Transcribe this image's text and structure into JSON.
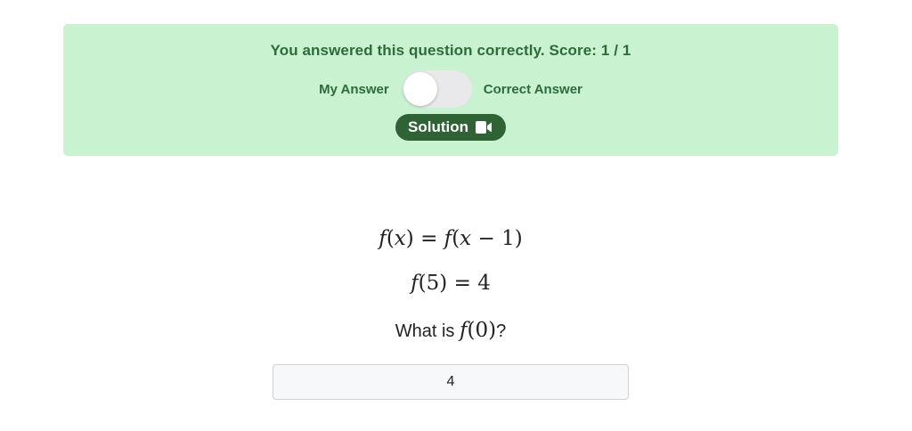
{
  "result": {
    "message": "You answered this question correctly. Score: 1 / 1",
    "toggle": {
      "left_label": "My Answer",
      "right_label": "Correct Answer",
      "state": "My Answer"
    },
    "solution_button": {
      "label": "Solution",
      "icon": "video-camera-icon"
    }
  },
  "problem": {
    "equation_1": {
      "lhs_fn": "f",
      "lhs_arg": "x",
      "equals": "=",
      "rhs_fn": "f",
      "rhs_arg": "x",
      "rhs_op": "−",
      "rhs_num": "1"
    },
    "equation_2": {
      "fn": "f",
      "arg": "5",
      "equals": "=",
      "value": "4"
    },
    "question": {
      "prefix": "What is ",
      "fn": "f",
      "arg": "0",
      "suffix": "?"
    }
  },
  "answer": {
    "value": "4"
  },
  "colors": {
    "banner_bg": "#c9f2d0",
    "banner_text": "#2e6b3a",
    "button_bg": "#2f6335",
    "toggle_track": "#e9e9ec"
  }
}
